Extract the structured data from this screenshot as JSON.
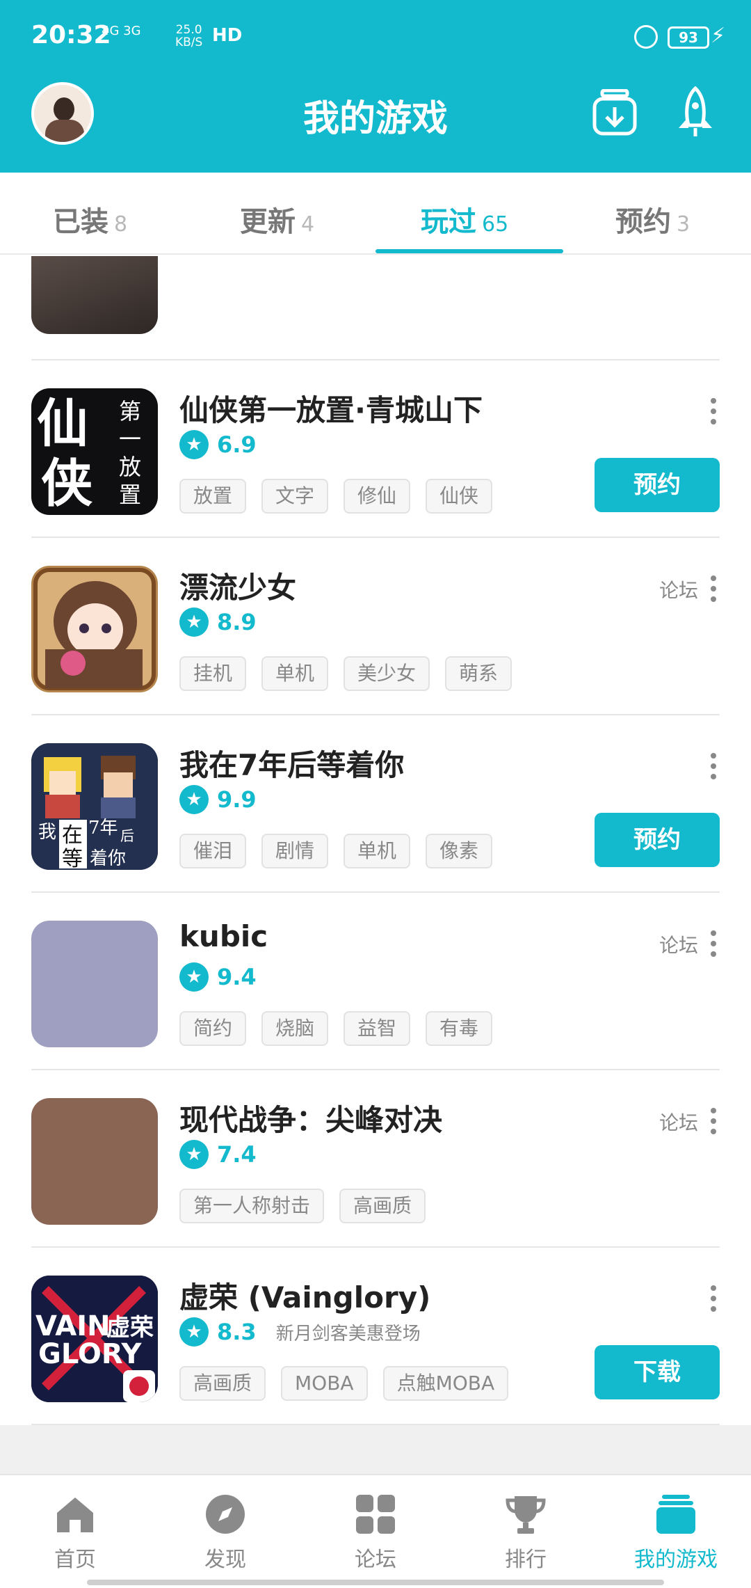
{
  "status": {
    "time": "20:32",
    "net": "4G 3G",
    "speed_top": "25.0",
    "speed_bottom": "KB/S",
    "hd": "HD",
    "battery": "93"
  },
  "header": {
    "title": "我的游戏"
  },
  "tabs": [
    {
      "label": "已装",
      "count": "8"
    },
    {
      "label": "更新",
      "count": "4"
    },
    {
      "label": "玩过",
      "count": "65"
    },
    {
      "label": "预约",
      "count": "3"
    }
  ],
  "games": [
    {
      "name": "仙侠第一放置·青城山下",
      "score": "6.9",
      "tags": [
        "放置",
        "文字",
        "修仙",
        "仙侠"
      ],
      "button": "预约",
      "forum": "",
      "sub": ""
    },
    {
      "name": "漂流少女",
      "score": "8.9",
      "tags": [
        "挂机",
        "单机",
        "美少女",
        "萌系"
      ],
      "button": "",
      "forum": "论坛",
      "sub": ""
    },
    {
      "name": "我在7年后等着你",
      "score": "9.9",
      "tags": [
        "催泪",
        "剧情",
        "单机",
        "像素"
      ],
      "button": "预约",
      "forum": "",
      "sub": ""
    },
    {
      "name": "kubic",
      "score": "9.4",
      "tags": [
        "简约",
        "烧脑",
        "益智",
        "有毒"
      ],
      "button": "",
      "forum": "论坛",
      "sub": ""
    },
    {
      "name": "现代战争：尖峰对决",
      "score": "7.4",
      "tags": [
        "第一人称射击",
        "高画质"
      ],
      "button": "",
      "forum": "论坛",
      "sub": ""
    },
    {
      "name": "虚荣 (Vainglory)",
      "score": "8.3",
      "tags": [
        "高画质",
        "MOBA",
        "点触MOBA"
      ],
      "button": "下载",
      "forum": "",
      "sub": "新月剑客美惠登场"
    }
  ],
  "icon_text": {
    "g0": [
      "仙",
      "侠",
      "第",
      "一",
      "放",
      "置"
    ],
    "g2": [
      "我",
      "在",
      "7年",
      "后",
      "等",
      "着你"
    ],
    "g5": [
      "VAIN",
      "GLORY",
      "虚荣"
    ]
  },
  "nav": [
    {
      "label": "首页",
      "icon": "home-icon"
    },
    {
      "label": "发现",
      "icon": "compass-icon"
    },
    {
      "label": "论坛",
      "icon": "grid-icon"
    },
    {
      "label": "排行",
      "icon": "trophy-icon"
    },
    {
      "label": "我的游戏",
      "icon": "stack-icon"
    }
  ],
  "colors": {
    "accent": "#13B9CC",
    "kubic": "#9E9FC1",
    "modern_war": "#8A6553"
  }
}
